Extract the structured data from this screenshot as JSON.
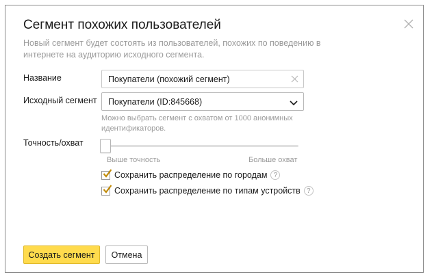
{
  "dialog": {
    "title": "Сегмент похожих пользователей",
    "description": "Новый сегмент будет состоять из пользователей, похожих по поведению в интернете на аудиторию исходного сегмента."
  },
  "form": {
    "name_label": "Название",
    "name_value": "Покупатели (похожий сегмент)",
    "source_label": "Исходный сегмент",
    "source_value": "Покупатели (ID:845668)",
    "source_hint": "Можно выбрать сегмент с охватом от 1000 анонимных идентификаторов.",
    "precision_label": "Точность/охват",
    "slider_value": 0,
    "slider_min_label": "Выше точность",
    "slider_max_label": "Больше охват",
    "checkboxes": [
      {
        "label": "Сохранить распределение по городам",
        "checked": true
      },
      {
        "label": "Сохранить распределение по типам устройств",
        "checked": true
      }
    ],
    "help_glyph": "?"
  },
  "buttons": {
    "create": "Создать сегмент",
    "cancel": "Отмена"
  },
  "colors": {
    "primary_button": "#ffdb4d",
    "checkmark": "#c28c0a"
  }
}
